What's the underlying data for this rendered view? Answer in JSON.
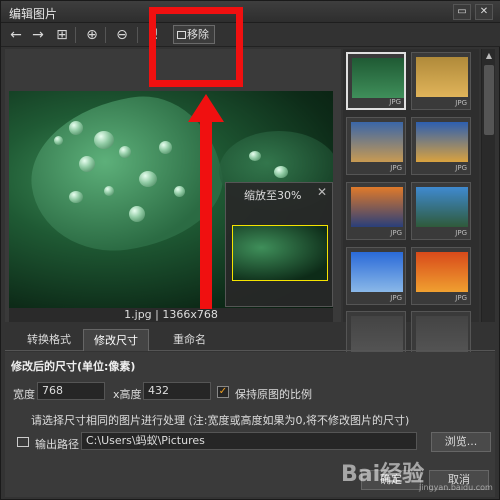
{
  "window": {
    "title": "编辑图片",
    "minimize": "▭",
    "close": "✕"
  },
  "toolbar": {
    "icons": [
      "back-arrow-icon",
      "forward-arrow-icon",
      "add-icon",
      "zoom-in-icon",
      "zoom-out-icon",
      "warning-icon"
    ],
    "remove_label": "移除",
    "tooltip": "移除"
  },
  "preview": {
    "caption": "1.jpg | 1366x768",
    "zoom_label": "缩放至30%",
    "zoom_close": "✕"
  },
  "thumbnails": [
    {
      "tag": "JPG",
      "selected": true,
      "colors": [
        "#1f5a34",
        "#3f8f5a"
      ]
    },
    {
      "tag": "JPG",
      "selected": false,
      "colors": [
        "#b08a3a",
        "#e0b45a"
      ]
    },
    {
      "tag": "JPG",
      "selected": false,
      "colors": [
        "#3a66a8",
        "#c89a52"
      ]
    },
    {
      "tag": "JPG",
      "selected": false,
      "colors": [
        "#2d5fb0",
        "#d9a23f"
      ]
    },
    {
      "tag": "JPG",
      "selected": false,
      "colors": [
        "#e07a2a",
        "#2a3f7a"
      ]
    },
    {
      "tag": "JPG",
      "selected": false,
      "colors": [
        "#3f8ad0",
        "#2f5a3a"
      ]
    },
    {
      "tag": "JPG",
      "selected": false,
      "colors": [
        "#2a6ad8",
        "#8ab8e8"
      ]
    },
    {
      "tag": "JPG",
      "selected": false,
      "colors": [
        "#d84a1a",
        "#f0a030"
      ]
    },
    {
      "tag": "",
      "selected": false,
      "colors": [
        "#444",
        "#555"
      ]
    },
    {
      "tag": "",
      "selected": false,
      "colors": [
        "#444",
        "#555"
      ]
    }
  ],
  "tabs": [
    {
      "label": "转换格式",
      "active": false
    },
    {
      "label": "修改尺寸",
      "active": true
    },
    {
      "label": "重命名",
      "active": false
    }
  ],
  "resize": {
    "section_title": "修改后的尺寸(单位:像素)",
    "width_label": "宽度",
    "width_value": "768",
    "height_label": "x高度",
    "height_value": "432",
    "keep_ratio_label": "保持原图的比例",
    "keep_ratio_checked": true,
    "note": "请选择尺寸相同的图片进行处理 (注:宽度或高度如果为0,将不修改图片的尺寸)",
    "output_label": "输出路径",
    "output_path": "C:\\Users\\蚂蚁\\Pictures",
    "browse_label": "浏览...",
    "ok_label": "确定",
    "cancel_label": "取消"
  },
  "watermark": {
    "main": "Bai经验",
    "sub": "jingyan.baidu.com"
  },
  "colors": {
    "highlight_red": "#f01010",
    "zoom_frame": "#f5e400",
    "checkbox": "#f0a020"
  }
}
